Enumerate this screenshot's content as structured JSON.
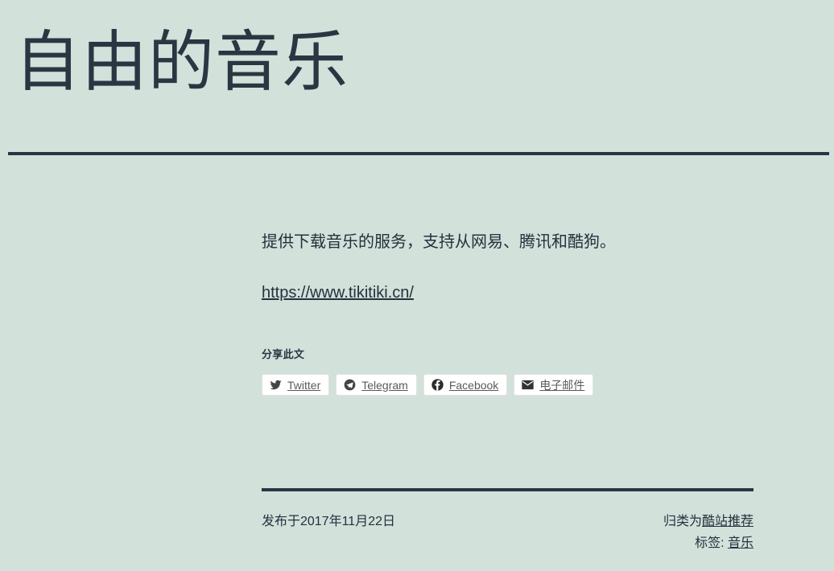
{
  "site": {
    "title": "自由的音乐"
  },
  "article": {
    "paragraph": "提供下载音乐的服务，支持从网易、腾讯和酷狗。",
    "link_text": "https://www.tikitiki.cn/"
  },
  "share": {
    "heading": "分享此文",
    "buttons": [
      {
        "label": "Twitter",
        "icon": "twitter-icon"
      },
      {
        "label": "Telegram",
        "icon": "telegram-icon"
      },
      {
        "label": "Facebook",
        "icon": "facebook-icon"
      },
      {
        "label": "电子邮件",
        "icon": "email-icon"
      }
    ]
  },
  "footer": {
    "published": "发布于2017年11月22日",
    "category_prefix": "归类为",
    "category_link": "酷站推荐",
    "tags_prefix": "标签: ",
    "tag_link": "音乐"
  },
  "colors": {
    "background": "#d2e1da",
    "text": "#25313d",
    "rule": "#2a3642",
    "button_background": "#ffffff",
    "button_border": "#e3e3e3",
    "button_text": "#5a5a5a"
  }
}
